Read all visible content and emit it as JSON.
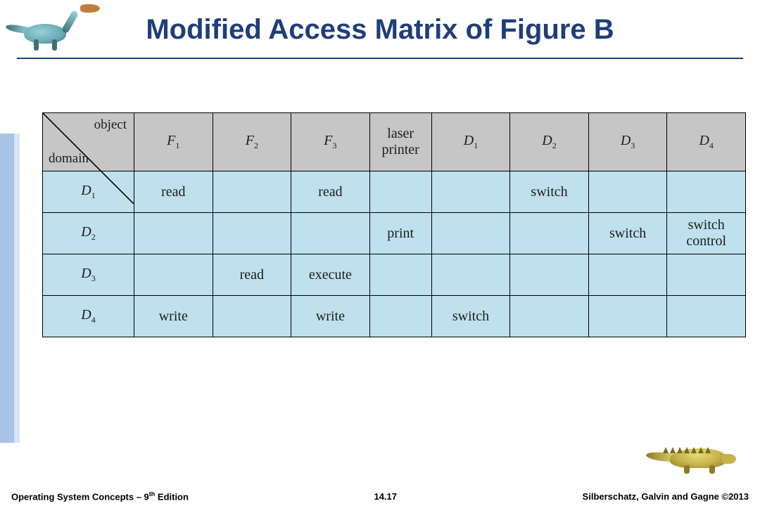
{
  "title": "Modified Access Matrix of Figure B",
  "header": {
    "object_label": "object",
    "domain_label": "domain",
    "objects": [
      "F1",
      "F2",
      "F3",
      "laser printer",
      "D1",
      "D2",
      "D3",
      "D4"
    ]
  },
  "rows": [
    {
      "domain": "D1",
      "cells": [
        "read",
        "",
        "read",
        "",
        "",
        "switch",
        "",
        ""
      ]
    },
    {
      "domain": "D2",
      "cells": [
        "",
        "",
        "",
        "print",
        "",
        "",
        "switch",
        "switch control"
      ]
    },
    {
      "domain": "D3",
      "cells": [
        "",
        "read",
        "execute",
        "",
        "",
        "",
        "",
        ""
      ]
    },
    {
      "domain": "D4",
      "cells": [
        "write",
        "",
        "write",
        "",
        "switch",
        "",
        "",
        ""
      ]
    }
  ],
  "footer": {
    "left_a": "Operating System Concepts – 9",
    "left_sup": "th",
    "left_b": " Edition",
    "center": "14.17",
    "right": "Silberschatz, Galvin and Gagne ©2013"
  }
}
